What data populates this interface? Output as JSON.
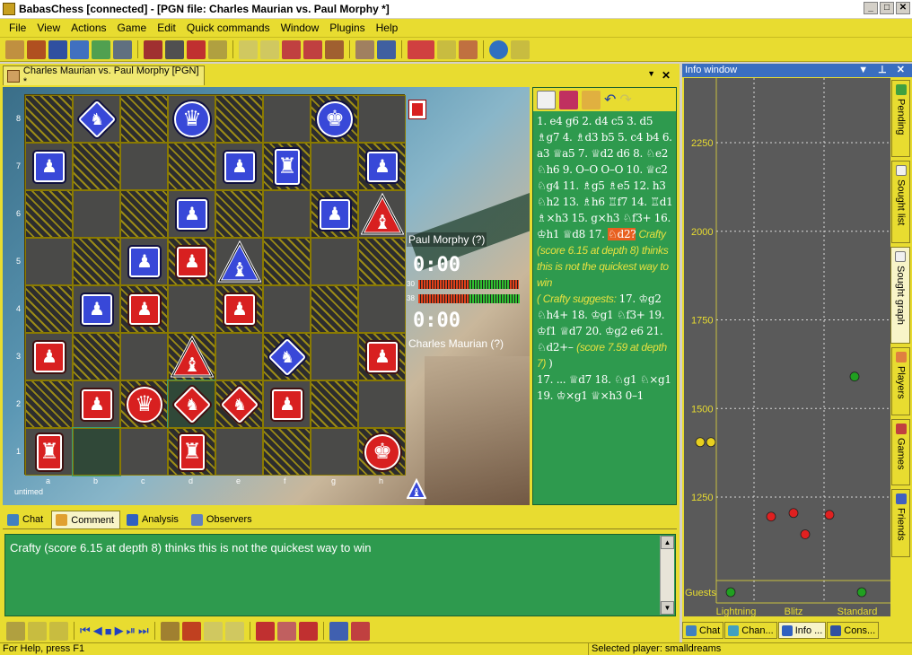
{
  "window": {
    "title": "BabasChess [connected] - [PGN file: Charles Maurian vs. Paul Morphy *]",
    "min": "_",
    "max": "□",
    "close": "✕"
  },
  "menu": [
    "File",
    "View",
    "Actions",
    "Game",
    "Edit",
    "Quick commands",
    "Window",
    "Plugins",
    "Help"
  ],
  "doc_tab": {
    "label": "Charles Maurian vs. Paul Morphy [PGN] *",
    "dropdown": "▼",
    "close": "✕"
  },
  "board": {
    "rank_labels": [
      "8",
      "7",
      "6",
      "5",
      "4",
      "3",
      "2",
      "1"
    ],
    "file_labels": [
      "a",
      "b",
      "c",
      "d",
      "e",
      "f",
      "g",
      "h"
    ],
    "untimed": "untimed",
    "pieces": [
      {
        "sq": "b8",
        "side": "w",
        "glyph": "♞",
        "shape": "diamond"
      },
      {
        "sq": "d8",
        "side": "w",
        "glyph": "♛",
        "shape": "round"
      },
      {
        "sq": "g8",
        "side": "w",
        "glyph": "♚",
        "shape": "round"
      },
      {
        "sq": "a7",
        "side": "w",
        "glyph": "♟",
        "shape": "box"
      },
      {
        "sq": "e7",
        "side": "w",
        "glyph": "♟",
        "shape": "box"
      },
      {
        "sq": "f7",
        "side": "w",
        "glyph": "♜",
        "shape": "tall"
      },
      {
        "sq": "h7",
        "side": "w",
        "glyph": "♟",
        "shape": "box"
      },
      {
        "sq": "d6",
        "side": "w",
        "glyph": "♟",
        "shape": "box"
      },
      {
        "sq": "g6",
        "side": "w",
        "glyph": "♟",
        "shape": "box"
      },
      {
        "sq": "h6",
        "side": "b",
        "glyph": "♝",
        "shape": "tri"
      },
      {
        "sq": "c5",
        "side": "w",
        "glyph": "♟",
        "shape": "box"
      },
      {
        "sq": "d5",
        "side": "b",
        "glyph": "♟",
        "shape": "box"
      },
      {
        "sq": "e5",
        "side": "w",
        "glyph": "♝",
        "shape": "tri"
      },
      {
        "sq": "b4",
        "side": "w",
        "glyph": "♟",
        "shape": "box"
      },
      {
        "sq": "c4",
        "side": "b",
        "glyph": "♟",
        "shape": "box"
      },
      {
        "sq": "e4",
        "side": "b",
        "glyph": "♟",
        "shape": "box"
      },
      {
        "sq": "a3",
        "side": "b",
        "glyph": "♟",
        "shape": "box"
      },
      {
        "sq": "d3",
        "side": "b",
        "glyph": "♝",
        "shape": "tri"
      },
      {
        "sq": "f3",
        "side": "w",
        "glyph": "♞",
        "shape": "diamond"
      },
      {
        "sq": "h3",
        "side": "b",
        "glyph": "♟",
        "shape": "box"
      },
      {
        "sq": "b2",
        "side": "b",
        "glyph": "♟",
        "shape": "box"
      },
      {
        "sq": "c2",
        "side": "b",
        "glyph": "♛",
        "shape": "round"
      },
      {
        "sq": "d2",
        "side": "b",
        "glyph": "♞",
        "shape": "diamond"
      },
      {
        "sq": "e2",
        "side": "b",
        "glyph": "♞",
        "shape": "diamond"
      },
      {
        "sq": "f2",
        "side": "b",
        "glyph": "♟",
        "shape": "box"
      },
      {
        "sq": "a1",
        "side": "b",
        "glyph": "♜",
        "shape": "tall"
      },
      {
        "sq": "d1",
        "side": "b",
        "glyph": "♜",
        "shape": "tall"
      },
      {
        "sq": "h1",
        "side": "b",
        "glyph": "♚",
        "shape": "round"
      }
    ],
    "highlight": [
      "b1",
      "d2"
    ]
  },
  "clock": {
    "top_name": "Paul Morphy (?)",
    "top_time": "0:00",
    "bot_name": "Charles Maurian (?)",
    "bot_time": "0:00",
    "bar1_label": "30",
    "bar2_label": "38",
    "bar1_green_fraction": 0.4,
    "bar2_green_fraction": 0.5
  },
  "pgn": {
    "before": "1. e4 g6 2. d4 c5 3. d5 ♗g7 4. ♗d3 b5 5. c4 b4 6. a3 ♕a5 7. ♕d2 d6 8. ♘e2 ♘h6 9. O–O O–O 10. ♕c2 ♘g4 11. ♗g5 ♗e5 12. h3 ♘h2 13. ♗h6 ♖f7 14. ♖d1 ♗×h3 15. g×h3 ♘f3+ 16. ♔h1 ♕d8 17. ",
    "current": "♘d2?",
    "comment1": " Crafty (score 6.15 at depth 8) thinks this is not the quickest way to win",
    "var_open": "( Crafty suggests: ",
    "variation": "17. ♔g2 ♘h4+ 18. ♔g1 ♘f3+ 19. ♔f1 ♕d7 20. ♔g2 e6 21. ♘d2+– ",
    "var_comment": "(score 7.59 at depth 7) ",
    "var_close": ")",
    "after": "17. ... ♕d7 18. ♘g1 ♘×g1 19. ♔×g1 ♕×h3 0–1"
  },
  "bottom_tabs": [
    "Chat",
    "Comment",
    "Analysis",
    "Observers"
  ],
  "comment_text": "Crafty (score 6.15 at depth 8) thinks this is not the quickest way to win",
  "status": {
    "help": "For Help, press F1",
    "selected": "Selected player: smalldreams"
  },
  "info": {
    "title": "Info window",
    "pin": "▼ ⊥ ✕"
  },
  "sought_graph": {
    "y_labels": [
      "2250",
      "2000",
      "1750",
      "1500",
      "1250",
      "Guests"
    ],
    "x_labels": [
      "Lightning",
      "Blitz",
      "Standard"
    ],
    "points": [
      {
        "color": "#e8d020",
        "category": "Lightning",
        "rating": 1405
      },
      {
        "color": "#e8d020",
        "category": "Lightning",
        "rating": 1405
      },
      {
        "color": "#e02020",
        "category": "Blitz",
        "rating": 1195
      },
      {
        "color": "#e02020",
        "category": "Blitz",
        "rating": 1205
      },
      {
        "color": "#e02020",
        "category": "Blitz",
        "rating": 1145
      },
      {
        "color": "#e02020",
        "category": "Standard",
        "rating": 1200
      },
      {
        "color": "#20a020",
        "category": "Standard",
        "rating": 1590
      },
      {
        "color": "#20a020",
        "category": "Lightning",
        "rating": "Guests"
      },
      {
        "color": "#20a020",
        "category": "Standard",
        "rating": "Guests"
      }
    ]
  },
  "side_tabs": [
    "Pending",
    "Sought list",
    "Sought graph",
    "Players",
    "Games",
    "Friends"
  ],
  "right_bottom_tabs": [
    "Chat",
    "Chan...",
    "Info ...",
    "Cons..."
  ]
}
